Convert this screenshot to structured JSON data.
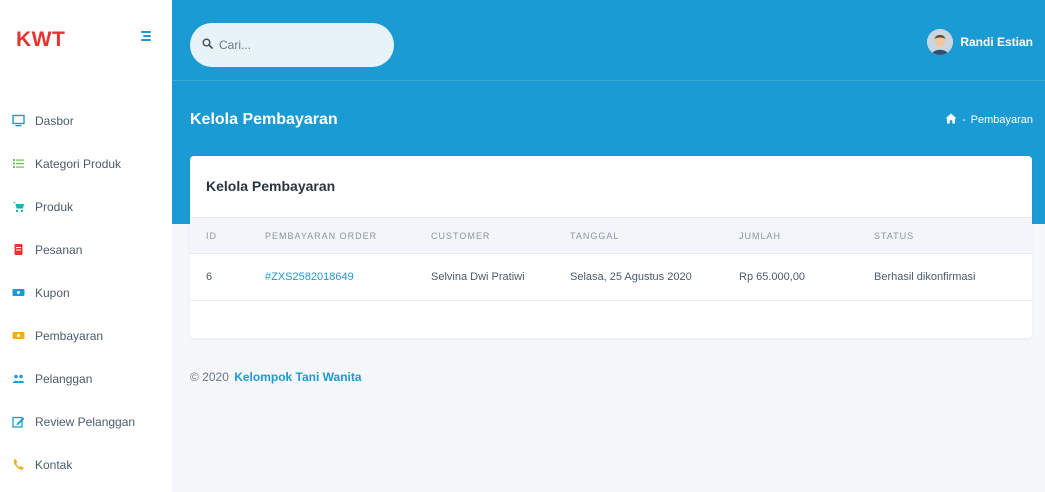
{
  "brand": {
    "name": "KWT"
  },
  "sidebar": {
    "items": [
      {
        "label": "Dasbor",
        "icon": "monitor-icon"
      },
      {
        "label": "Kategori Produk",
        "icon": "list-icon"
      },
      {
        "label": "Produk",
        "icon": "cart-icon"
      },
      {
        "label": "Pesanan",
        "icon": "document-icon"
      },
      {
        "label": "Kupon",
        "icon": "ticket-icon"
      },
      {
        "label": "Pembayaran",
        "icon": "money-icon"
      },
      {
        "label": "Pelanggan",
        "icon": "users-icon"
      },
      {
        "label": "Review Pelanggan",
        "icon": "edit-icon"
      },
      {
        "label": "Kontak",
        "icon": "phone-icon"
      }
    ]
  },
  "search": {
    "placeholder": "Cari..."
  },
  "user": {
    "name": "Randi Estian"
  },
  "header": {
    "title": "Kelola Pembayaran",
    "breadcrumb": {
      "home_icon": "home-icon",
      "separator": "-",
      "current": "Pembayaran"
    }
  },
  "card": {
    "title": "Kelola Pembayaran",
    "columns": [
      "ID",
      "PEMBAYARAN ORDER",
      "CUSTOMER",
      "TANGGAL",
      "JUMLAH",
      "STATUS"
    ],
    "rows": [
      {
        "id": "6",
        "order": "#ZXS2582018649",
        "customer": "Selvina Dwi Pratiwi",
        "date": "Selasa, 25 Agustus 2020",
        "amount": "Rp 65.000,00",
        "status": "Berhasil dikonfirmasi"
      }
    ]
  },
  "footer": {
    "copyright": "© 2020",
    "brand": "Kelompok Tani Wanita"
  },
  "colors": {
    "primary": "#1a9bd3",
    "brand": "#e3342f",
    "background": "#f5f7fb"
  }
}
